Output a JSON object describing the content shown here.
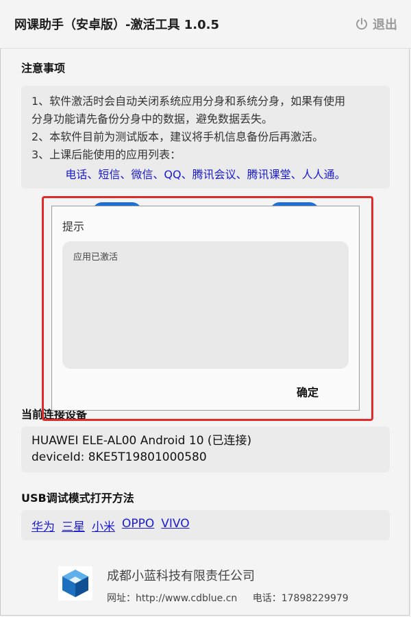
{
  "header": {
    "title": "网课助手（安卓版）-激活工具 1.0.5",
    "exit_label": "退出",
    "exit_icon": "power-icon"
  },
  "notice": {
    "heading": "注意事项",
    "lines": [
      "1、软件激活时会自动关闭系统应用分身和系统分身，如果有使用",
      "分身功能请先备份分身中的数据，避免数据丢失。",
      "2、本软件目前为测试版本，建议将手机信息备份后再激活。",
      "3、上课后能使用的应用列表："
    ],
    "apps": "电话、短信、微信、QQ、腾讯会议、腾讯课堂、人人通。"
  },
  "device": {
    "heading": "当前连接设备",
    "line1": "HUAWEI ELE-AL00 Android 10 (已连接)",
    "line2": "deviceId: 8KE5T19801000580"
  },
  "usb": {
    "heading": "USB调试模式打开方法",
    "links": [
      "华为",
      "三星",
      "小米",
      "OPPO",
      "VIVO"
    ]
  },
  "footer": {
    "company": "成都小蓝科技有限责任公司",
    "website": "网址：http://www.cdblue.cn",
    "phone": "电话：17898229979"
  },
  "dialog": {
    "title": "提示",
    "message": "应用已激活",
    "ok_label": "确定"
  },
  "colors": {
    "link": "#1a1ad6",
    "highlight": "#e02b2b",
    "accent_button": "#1e6fd6"
  }
}
